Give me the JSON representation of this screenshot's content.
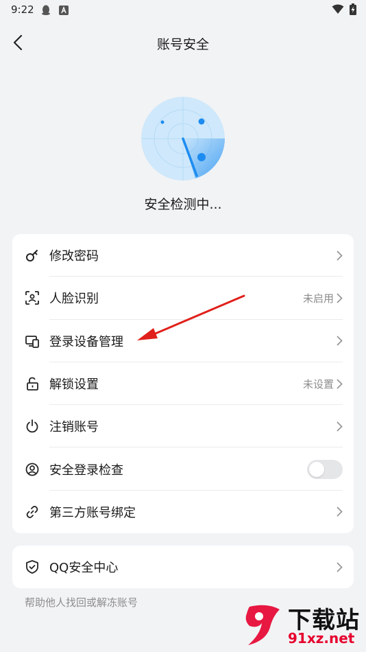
{
  "status_bar": {
    "time": "9:22"
  },
  "nav": {
    "title": "账号安全"
  },
  "scan": {
    "status_text": "安全检测中..."
  },
  "menu": {
    "items": [
      {
        "label": "修改密码",
        "value": ""
      },
      {
        "label": "人脸识别",
        "value": "未启用"
      },
      {
        "label": "登录设备管理",
        "value": ""
      },
      {
        "label": "解锁设置",
        "value": "未设置"
      },
      {
        "label": "注销账号",
        "value": ""
      },
      {
        "label": "安全登录检查",
        "value": ""
      },
      {
        "label": "第三方账号绑定",
        "value": ""
      }
    ],
    "safe_login_check_enabled": false
  },
  "qq_center": {
    "label": "QQ安全中心",
    "tip": "帮助他人找回或解冻账号"
  },
  "watermark": {
    "title": "下载站",
    "url": "91xz.net"
  },
  "colors": {
    "accent": "#1c8cf0",
    "radar_bg": "#cfe8fb",
    "annotation_arrow": "#e0201b",
    "watermark_red": "#e6002e"
  }
}
